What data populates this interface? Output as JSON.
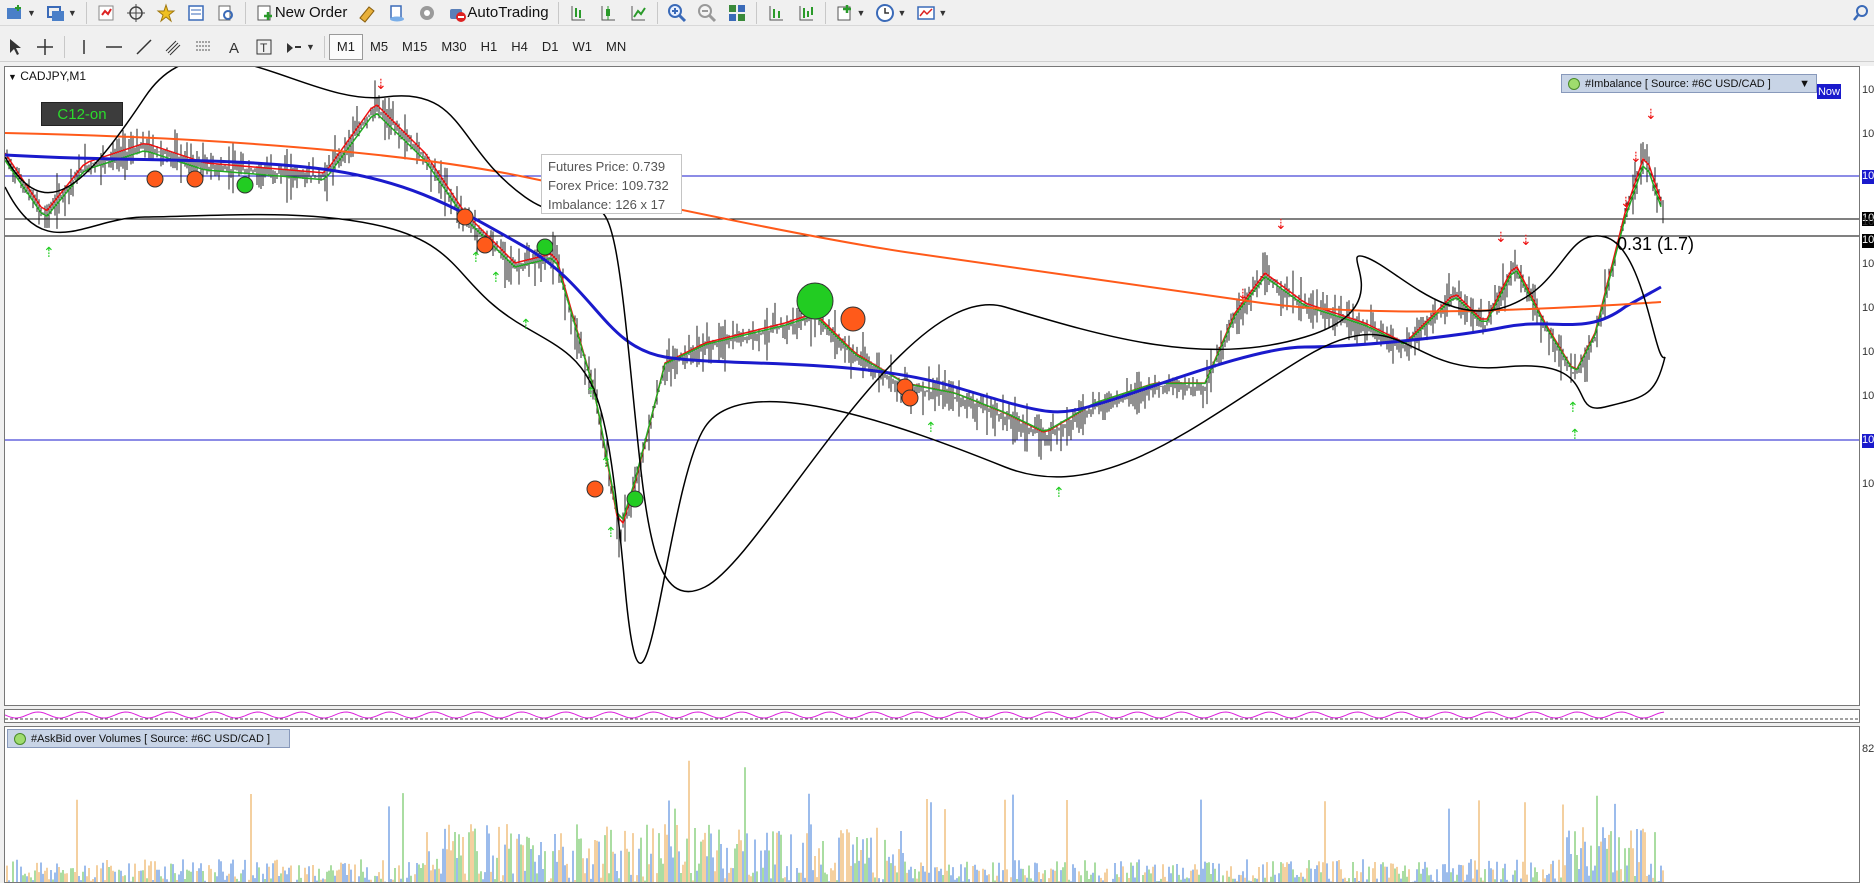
{
  "toolbar1": {
    "new_order_label": "New Order",
    "autotrading_label": "AutoTrading"
  },
  "toolbar2": {
    "timeframes": [
      "M1",
      "M5",
      "M15",
      "M30",
      "H1",
      "H4",
      "D1",
      "W1",
      "MN"
    ],
    "active_timeframe": "M1"
  },
  "chart": {
    "symbol_title": "CADJPY,M1",
    "indicator_label": "C12-on",
    "imbalance_indicator": "#Imbalance [ Source: #6C USD/CAD ]",
    "now_label": "Now",
    "tooltip": {
      "line1": "Futures Price: 0.739",
      "line2": "Forex Price: 109.732",
      "line3": "Imbalance: 126 x 17"
    },
    "annotation": "0.31 (1.7)"
  },
  "subwindow": {
    "volume_indicator": "#AskBid over Volumes [ Source: #6C USD/CAD ]",
    "scale_top": "82"
  },
  "price_scale": {
    "labels": [
      "10",
      "10",
      "10",
      "10",
      "10",
      "10",
      "10",
      "10",
      "10",
      "10",
      "10",
      "10"
    ]
  },
  "colors": {
    "ma_blue": "#1a1acc",
    "ma_orange": "#ff5a1a",
    "arrow_green": "#22cc22",
    "arrow_red": "#ee1111"
  }
}
